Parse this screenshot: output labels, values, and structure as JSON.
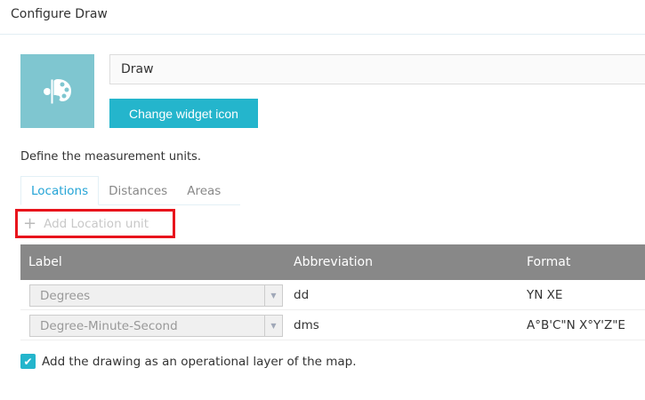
{
  "title": "Configure Draw",
  "widget": {
    "name": "Draw",
    "change_icon_label": "Change widget icon",
    "icon": "palette-icon"
  },
  "description": "Define the measurement units.",
  "tabs": [
    {
      "label": "Locations",
      "active": true
    },
    {
      "label": "Distances",
      "active": false
    },
    {
      "label": "Areas",
      "active": false
    }
  ],
  "add_unit_label": "Add Location unit",
  "table": {
    "headers": [
      "Label",
      "Abbreviation",
      "Format"
    ],
    "rows": [
      {
        "label": "Degrees",
        "abbr": "dd",
        "format": "YN XE"
      },
      {
        "label": "Degree-Minute-Second",
        "abbr": "dms",
        "format": "A°B'C\"N X°Y'Z\"E"
      }
    ]
  },
  "operational_layer": {
    "label": "Add the drawing as an operational layer of the map.",
    "checked": true
  },
  "colors": {
    "accent": "#24b5cc",
    "highlight": "#e8141c",
    "header": "#888888"
  }
}
